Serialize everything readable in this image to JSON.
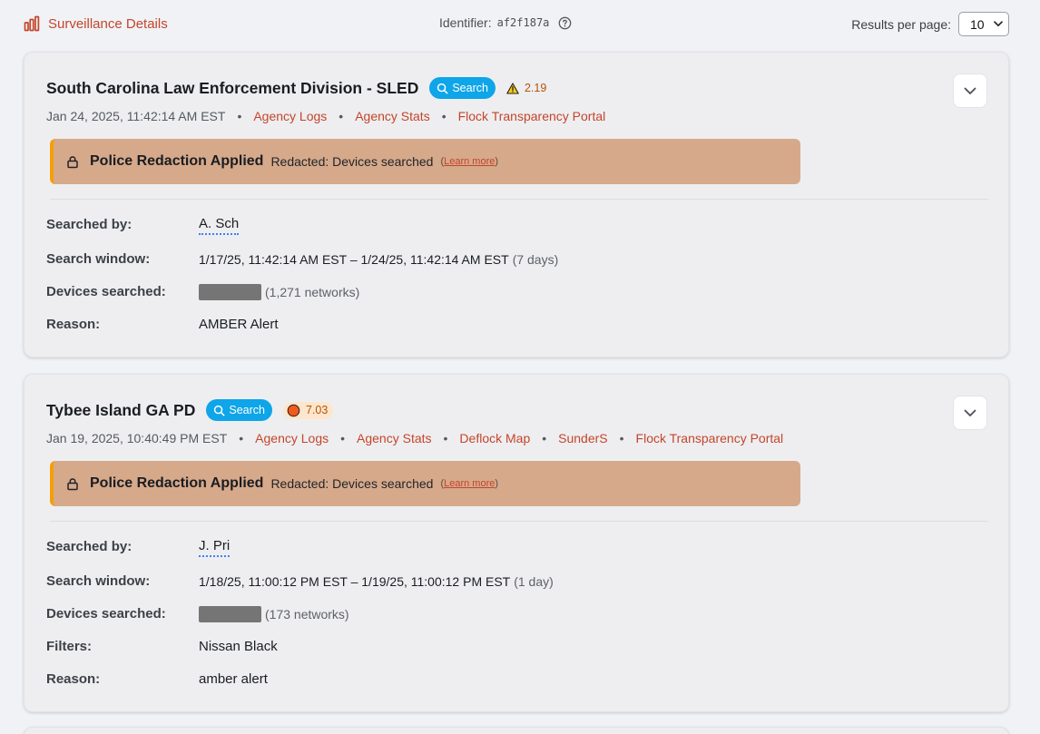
{
  "header": {
    "brand_label": "Surveillance Details",
    "brand_icon": "bar-chart-icon",
    "identifier_label": "Identifier:",
    "identifier_value": "af2f187a",
    "help_icon": "help-circle-icon",
    "results_label": "Results per page:",
    "results_value": "10"
  },
  "colors": {
    "accent": "#c4452b",
    "search_pill": "#0ea5e9",
    "redaction_bg": "#d6a98b",
    "redaction_border": "#f59e0b",
    "warning_score": "#b45309"
  },
  "cards": [
    {
      "agency": "South Carolina Law Enforcement Division - SLED",
      "search_label": "Search",
      "score_icon": "warning-triangle-icon",
      "score": "2.19",
      "timestamp": "Jan 24, 2025, 11:42:14 AM EST",
      "links": [
        "Agency Logs",
        "Agency Stats",
        "Flock Transparency Portal"
      ],
      "redaction": {
        "title": "Police Redaction Applied",
        "desc": "Redacted: Devices searched",
        "learn_open": "(",
        "learn_more": "Learn more",
        "learn_close": ")"
      },
      "fields": {
        "searched_by_label": "Searched by:",
        "searched_by": "A. Sch",
        "window_label": "Search window:",
        "window": "1/17/25, 11:42:14 AM EST – 1/24/25, 11:42:14 AM EST",
        "window_duration": "(7 days)",
        "devices_label": "Devices searched:",
        "devices_networks": "(1,271 networks)",
        "reason_label": "Reason:",
        "reason": "AMBER Alert"
      }
    },
    {
      "agency": "Tybee Island GA PD",
      "search_label": "Search",
      "score_icon": "orange-circle-icon",
      "score": "7.03",
      "timestamp": "Jan 19, 2025, 10:40:49 PM EST",
      "links": [
        "Agency Logs",
        "Agency Stats",
        "Deflock Map",
        "SunderS",
        "Flock Transparency Portal"
      ],
      "redaction": {
        "title": "Police Redaction Applied",
        "desc": "Redacted: Devices searched",
        "learn_open": "(",
        "learn_more": "Learn more",
        "learn_close": ")"
      },
      "fields": {
        "searched_by_label": "Searched by:",
        "searched_by": "J. Pri",
        "window_label": "Search window:",
        "window": "1/18/25, 11:00:12 PM EST – 1/19/25, 11:00:12 PM EST",
        "window_duration": "(1 day)",
        "devices_label": "Devices searched:",
        "devices_networks": "(173 networks)",
        "filters_label": "Filters:",
        "filters": "Nissan Black",
        "reason_label": "Reason:",
        "reason": "amber alert"
      }
    }
  ]
}
